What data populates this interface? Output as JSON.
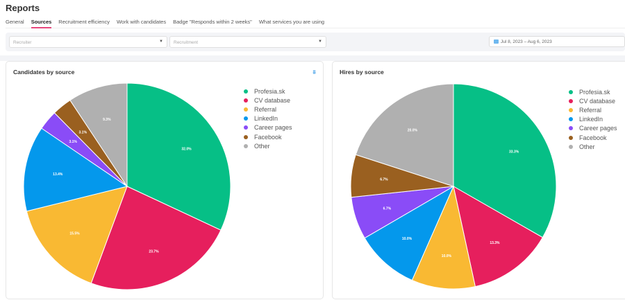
{
  "header": {
    "title": "Reports"
  },
  "tabs": [
    {
      "label": "General"
    },
    {
      "label": "Sources",
      "active": true
    },
    {
      "label": "Recruitment efficiency"
    },
    {
      "label": "Work with candidates"
    },
    {
      "label": "Badge \"Responds within 2 weeks\""
    },
    {
      "label": "What services you are using"
    }
  ],
  "filters": {
    "recruiter_placeholder": "Recruiter",
    "recruitment_placeholder": "Recruitment",
    "date_range": "Jul 8, 2023 – Aug 6, 2023"
  },
  "colors": [
    "#06bf86",
    "#e61f5d",
    "#f9b933",
    "#0498ec",
    "#8a4cf7",
    "#9a6020",
    "#b0b0b0"
  ],
  "chart_data": [
    {
      "type": "pie",
      "title": "Candidates by source",
      "categories": [
        "Profesia.sk",
        "CV database",
        "Referral",
        "LinkedIn",
        "Career pages",
        "Facebook",
        "Other"
      ],
      "values": [
        32.0,
        23.7,
        15.5,
        13.4,
        3.1,
        3.1,
        9.3
      ],
      "labels": [
        "32.0%",
        "23.7%",
        "15.5%",
        "13.4%",
        "3.1%",
        "3.1%",
        "9.3%"
      ],
      "legend": "right"
    },
    {
      "type": "pie",
      "title": "Hires by source",
      "categories": [
        "Profesia.sk",
        "CV database",
        "Referral",
        "LinkedIn",
        "Career pages",
        "Facebook",
        "Other"
      ],
      "values": [
        33.3,
        13.3,
        10.0,
        10.0,
        6.7,
        6.7,
        20.0
      ],
      "labels": [
        "33.3%",
        "13.3%",
        "10.0%",
        "10.0%",
        "6.7%",
        "6.7%",
        "20.0%"
      ],
      "legend": "right"
    }
  ]
}
